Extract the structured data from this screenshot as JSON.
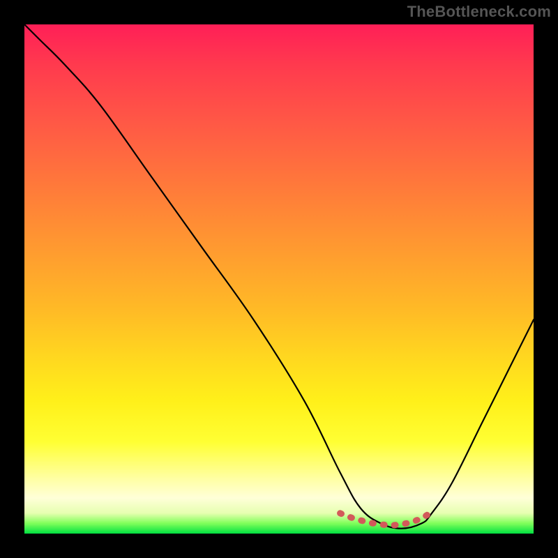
{
  "watermark": "TheBottleneck.com",
  "chart_data": {
    "type": "line",
    "title": "",
    "xlabel": "",
    "ylabel": "",
    "xlim": [
      0,
      100
    ],
    "ylim": [
      0,
      100
    ],
    "grid": false,
    "legend": false,
    "series": [
      {
        "name": "bottleneck-curve",
        "color": "#000000",
        "x": [
          0,
          3,
          8,
          15,
          25,
          35,
          45,
          55,
          62,
          66,
          70,
          74,
          78,
          80,
          84,
          90,
          95,
          100
        ],
        "values": [
          100,
          97,
          92,
          84,
          70,
          56,
          42,
          26,
          12,
          5,
          2,
          1,
          2,
          4,
          10,
          22,
          32,
          42
        ]
      }
    ],
    "trough_marker": {
      "name": "optimal-range",
      "color": "#d25a5a",
      "x": [
        62,
        64,
        66,
        68,
        70,
        72,
        74,
        76,
        78,
        80
      ],
      "values": [
        4,
        3.2,
        2.6,
        2.1,
        1.8,
        1.6,
        1.8,
        2.2,
        3.0,
        4.2
      ]
    }
  }
}
